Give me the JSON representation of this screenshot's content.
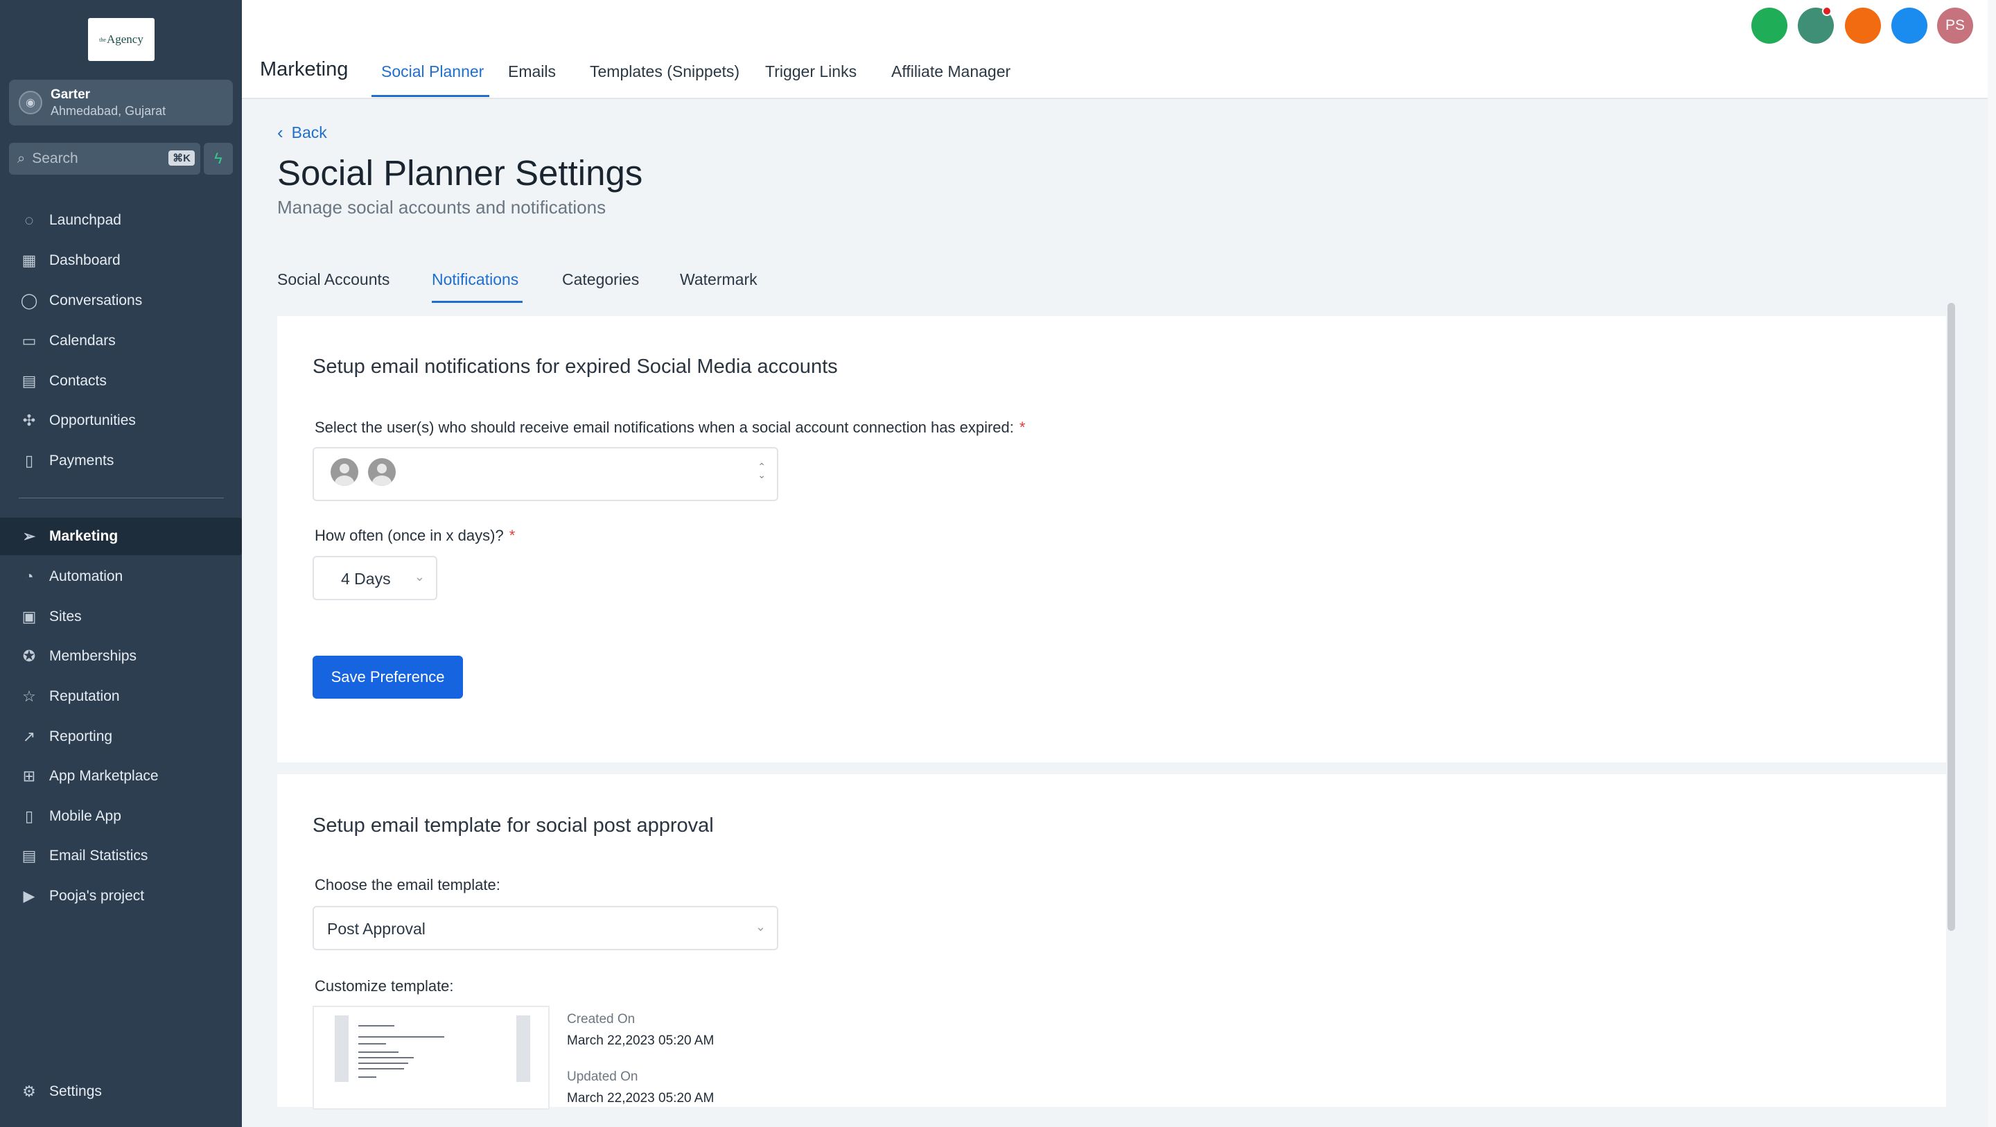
{
  "sidebar": {
    "logo_text": "Agency",
    "logo_sup": "the",
    "account": {
      "name": "Garter",
      "location": "Ahmedabad, Gujarat"
    },
    "search": {
      "placeholder": "Search",
      "shortcut": "⌘K"
    },
    "items": [
      {
        "label": "Launchpad",
        "icon": "rocket-icon"
      },
      {
        "label": "Dashboard",
        "icon": "dashboard-icon"
      },
      {
        "label": "Conversations",
        "icon": "chat-icon"
      },
      {
        "label": "Calendars",
        "icon": "calendar-icon"
      },
      {
        "label": "Contacts",
        "icon": "contacts-icon"
      },
      {
        "label": "Opportunities",
        "icon": "opportunities-icon"
      },
      {
        "label": "Payments",
        "icon": "payments-icon"
      },
      {
        "label": "Marketing",
        "icon": "send-icon",
        "active": true
      },
      {
        "label": "Automation",
        "icon": "automation-icon"
      },
      {
        "label": "Sites",
        "icon": "sites-icon"
      },
      {
        "label": "Memberships",
        "icon": "award-icon"
      },
      {
        "label": "Reputation",
        "icon": "star-icon"
      },
      {
        "label": "Reporting",
        "icon": "trend-icon"
      },
      {
        "label": "App Marketplace",
        "icon": "grid-icon"
      },
      {
        "label": "Mobile App",
        "icon": "mobile-icon"
      },
      {
        "label": "Email Statistics",
        "icon": "email-stats-icon"
      },
      {
        "label": "Pooja's project",
        "icon": "video-icon"
      }
    ],
    "settings_label": "Settings"
  },
  "topbar": {
    "module_title": "Marketing",
    "tabs": [
      "Social Planner",
      "Emails",
      "Templates (Snippets)",
      "Trigger Links",
      "Affiliate Manager"
    ],
    "active_tab": "Social Planner",
    "user_initials": "PS",
    "status_colors": [
      "#1fad58",
      "#3f8f76",
      "#f26b10",
      "#1a8cf0"
    ]
  },
  "page": {
    "back_label": "Back",
    "title": "Social Planner Settings",
    "subtitle": "Manage social accounts and notifications",
    "tabs": [
      "Social Accounts",
      "Notifications",
      "Categories",
      "Watermark"
    ],
    "active_tab": "Notifications"
  },
  "notifications_card": {
    "title": "Setup email notifications for expired Social Media accounts",
    "users_label": "Select the user(s) who should receive email notifications when a social account connection has expired:",
    "frequency_label": "How often (once in x days)?",
    "frequency_value": "4 Days",
    "save_button": "Save Preference"
  },
  "template_card": {
    "title": "Setup email template for social post approval",
    "choose_label": "Choose the email template:",
    "template_value": "Post Approval",
    "customize_label": "Customize template:",
    "created_label": "Created On",
    "created_value": "March 22,2023 05:20 AM",
    "updated_label": "Updated On",
    "updated_value": "March 22,2023 05:20 AM"
  }
}
